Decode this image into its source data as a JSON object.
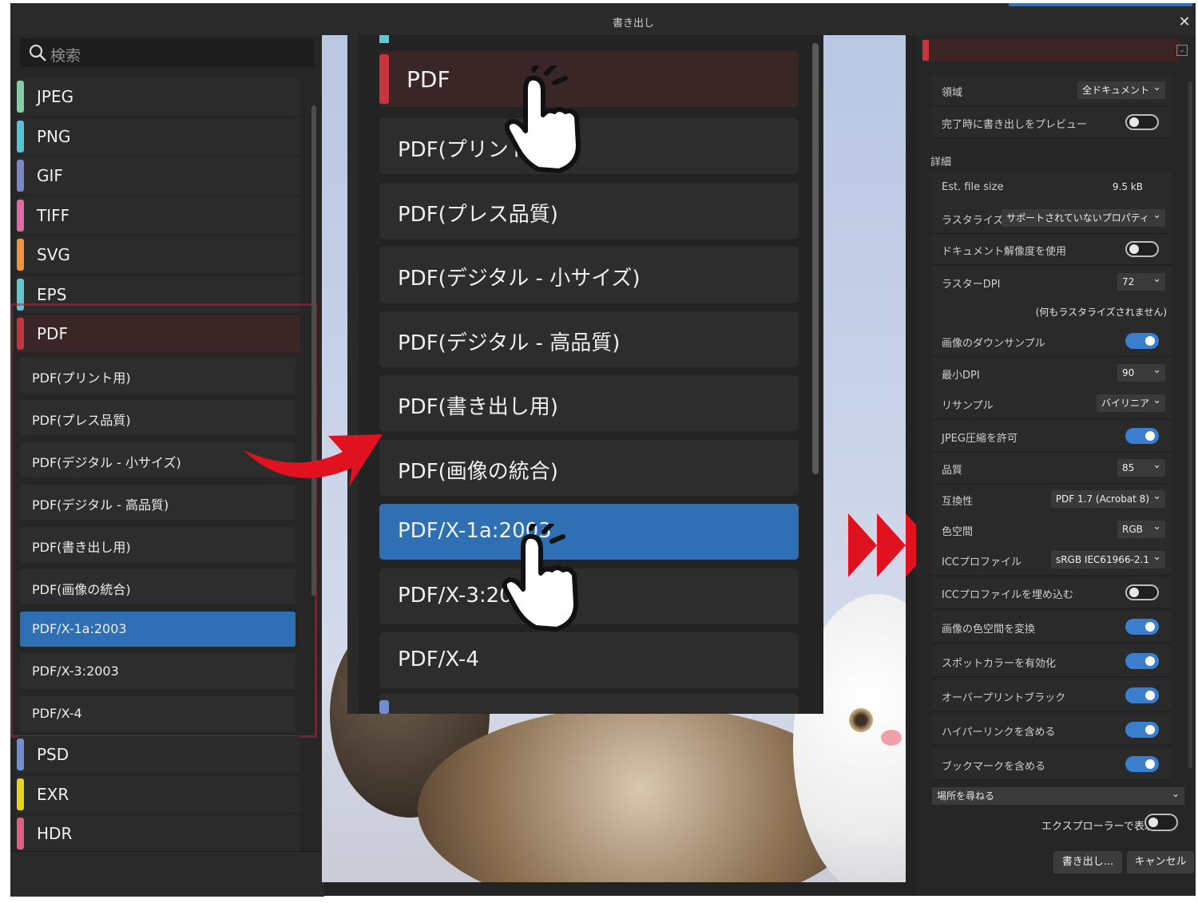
{
  "window": {
    "title": "書き出し",
    "close_glyph": "✕"
  },
  "search": {
    "placeholder": "検索",
    "icon": "search-icon"
  },
  "formats": [
    {
      "label": "JPEG",
      "color": "#7fd0a5"
    },
    {
      "label": "PNG",
      "color": "#52c5d8"
    },
    {
      "label": "GIF",
      "color": "#7a86c8"
    },
    {
      "label": "TIFF",
      "color": "#e06aa6"
    },
    {
      "label": "SVG",
      "color": "#f0953f"
    },
    {
      "label": "EPS",
      "color": "#62c6cf"
    },
    {
      "label": "PDF",
      "color": "#c9333b"
    }
  ],
  "pdf_presets": [
    "PDF(プリント用)",
    "PDF(プレス品質)",
    "PDF(デジタル - 小サイズ)",
    "PDF(デジタル - 高品質)",
    "PDF(書き出し用)",
    "PDF(画像の統合)",
    "PDF/X-1a:2003",
    "PDF/X-3:2003",
    "PDF/X-4"
  ],
  "selected_preset": "PDF/X-1a:2003",
  "formats_after": [
    {
      "label": "PSD",
      "color": "#6f8fd0"
    },
    {
      "label": "EXR",
      "color": "#e8d21a"
    },
    {
      "label": "HDR",
      "color": "#e35c86"
    }
  ],
  "zoom": {
    "header": "PDF",
    "items": [
      "PDF(プリント用",
      "PDF(プレス品質)",
      "PDF(デジタル - 小サイズ)",
      "PDF(デジタル - 高品質)",
      "PDF(書き出し用)",
      "PDF(画像の統合)",
      "PDF/X-1a:2003",
      "PDF/X-3:200",
      "PDF/X-4"
    ]
  },
  "settings": {
    "area": {
      "label": "領域",
      "value": "全ドキュメント"
    },
    "preview_on_finish": {
      "label": "完了時に書き出しをプレビュー",
      "on": false
    },
    "section_detail": "詳細",
    "est_file_size": {
      "label": "Est. file size",
      "value": "9.5 kB"
    },
    "rasterize": {
      "label": "ラスタライズ",
      "value": "サポートされていないプロパティ"
    },
    "use_doc_resolution": {
      "label": "ドキュメント解像度を使用",
      "on": false
    },
    "raster_dpi": {
      "label": "ラスターDPI",
      "value": "72"
    },
    "nothing_rasterized": "(何もラスタライズされません)",
    "downsample": {
      "label": "画像のダウンサンプル",
      "on": true
    },
    "min_dpi": {
      "label": "最小DPI",
      "value": "90"
    },
    "resample": {
      "label": "リサンプル",
      "value": "バイリニア"
    },
    "allow_jpeg": {
      "label": "JPEG圧縮を許可",
      "on": true
    },
    "quality": {
      "label": "品質",
      "value": "85"
    },
    "compat": {
      "label": "互換性",
      "value": "PDF 1.7 (Acrobat 8)"
    },
    "color_space": {
      "label": "色空間",
      "value": "RGB"
    },
    "icc_profile": {
      "label": "ICCプロファイル",
      "value": "sRGB IEC61966-2.1"
    },
    "embed_icc": {
      "label": "ICCプロファイルを埋め込む",
      "on": false
    },
    "convert_color": {
      "label": "画像の色空間を変換",
      "on": true
    },
    "spot_colors": {
      "label": "スポットカラーを有効化",
      "on": true
    },
    "overprint": {
      "label": "オーバープリントブラック",
      "on": true
    },
    "hyperlinks": {
      "label": "ハイパーリンクを含める",
      "on": true
    },
    "bookmarks": {
      "label": "ブックマークを含める",
      "on": true
    }
  },
  "footer": {
    "location": "場所を尋ねる",
    "show_in_explorer": "エクスプローラーで表示",
    "export_button": "書き出し...",
    "cancel_button": "キャンセル"
  },
  "colors": {
    "accent": "#2f6fb3",
    "pdf_bar": "#c9333b",
    "arrow": "#e0121f",
    "toggle_on": "#3a7fcf"
  }
}
